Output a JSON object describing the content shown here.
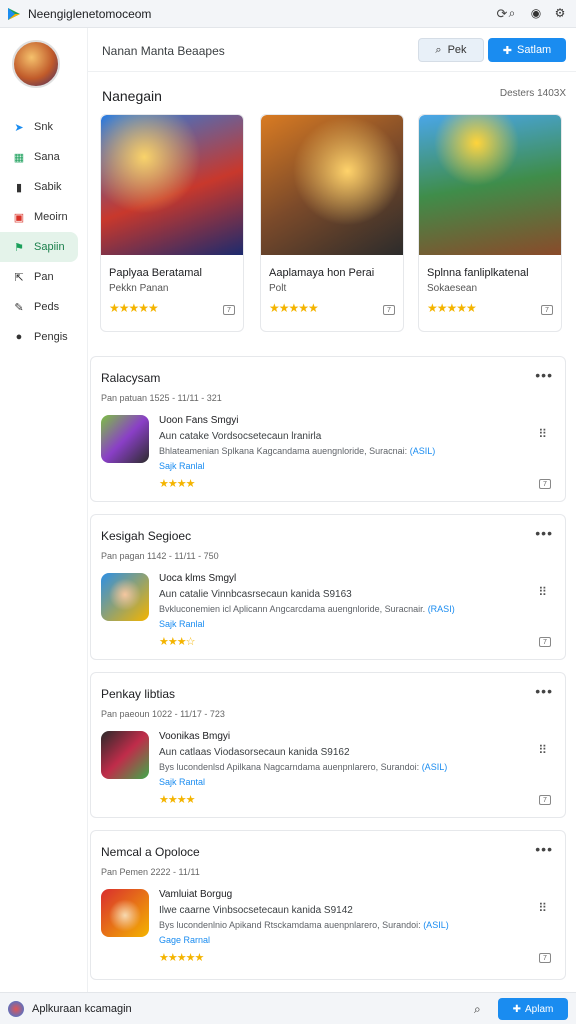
{
  "window": {
    "title": "Neengiglenetomoceom",
    "logo_icon": "store-logo-icon"
  },
  "sidebar": {
    "items": [
      {
        "label": "Snk",
        "icon": "cursor-icon",
        "color": "#1a8cf0"
      },
      {
        "label": "Sana",
        "icon": "grid-icon",
        "color": "#1a9f5a"
      },
      {
        "label": "Sabik",
        "icon": "bar-chart-icon",
        "color": "#333333"
      },
      {
        "label": "Meoirn",
        "icon": "bookmark-icon",
        "color": "#d93025"
      },
      {
        "label": "Sapiin",
        "icon": "flag-icon",
        "color": "#1a9f5a"
      },
      {
        "label": "Pan",
        "icon": "export-icon",
        "color": "#333333"
      },
      {
        "label": "Peds",
        "icon": "wrench-icon",
        "color": "#333333"
      },
      {
        "label": "Pengis",
        "icon": "chat-icon",
        "color": "#333333"
      }
    ]
  },
  "header": {
    "title": "Nanan Manta Beaapes",
    "peek_label": "Pek",
    "primary_label": "Satlam"
  },
  "featured": {
    "title": "Nanegain",
    "meta": "Desters 1403X",
    "cards": [
      {
        "name": "Paplyaa Beratamal",
        "sub": "Pekkn Panan",
        "stars": "★★★★★"
      },
      {
        "name": "Aaplamaya hon Perai",
        "sub": "Polt",
        "stars": "★★★★★"
      },
      {
        "name": "Splnna fanliplkatenal",
        "sub": "Sokaesean",
        "stars": "★★★★★"
      }
    ]
  },
  "lists": [
    {
      "title": "Ralacysam",
      "meta": "Pan patuan  1525  -  11/11  -  321",
      "name": "Uoon Fans Smgyi",
      "tag": "",
      "desc1": "Aun catake Vordsocsetecaun lranirla  ",
      "desc2": "Bhlateamenian Splkana Kagcandama auengnloride, Suracnai:",
      "link": "(ASIL)",
      "sale": "Sajk Ranlal",
      "stars": "★★★★"
    },
    {
      "title": "Kesigah Segioec",
      "meta": "Pan pagan  1142  -  11/11  -  750",
      "name": "Uoca klms Smgyl",
      "tag": "",
      "desc1": "Aun catalie Vinnbcasrsecaun kanida  S9163",
      "desc2": "Bvkluconemien icl Aplicann Angcarcdama auengnloride, Suracnair.",
      "link": "(RASI)",
      "sale": "Sajk Ranlal",
      "stars": "★★★☆"
    },
    {
      "title": "Penkay libtias",
      "meta": "Pan paeoun  1022  -  11/17  -  723",
      "name": "Voonikas Bmgyi",
      "tag": "",
      "desc1": "Aun catlaas Viodasorsecaun kanida  S9162",
      "desc2": "Bys lucondenlsd Apilkana Nagcarndama auenpnlarero, Surandoi:",
      "link": "(ASIL)",
      "sale": "Sajk Rantal",
      "stars": "★★★★"
    },
    {
      "title": "Nemcal a Opoloce",
      "meta": "Pan Pemen  2222  -  11/11",
      "name": "Vamluiat Borgug",
      "tag": "",
      "desc1": "Ilwe caarne Vinbsocsetecaun kanida  S9142",
      "desc2": "Bys lucondenlnio Apikand Rtsckamdama auenpnlarero, Surandoi:",
      "link": "(ASIL)",
      "sale": "Gage Rarnal",
      "stars": "★★★★★"
    }
  ],
  "bottom": {
    "text": "Aplkuraan kcamagin",
    "button": "Aplam"
  }
}
